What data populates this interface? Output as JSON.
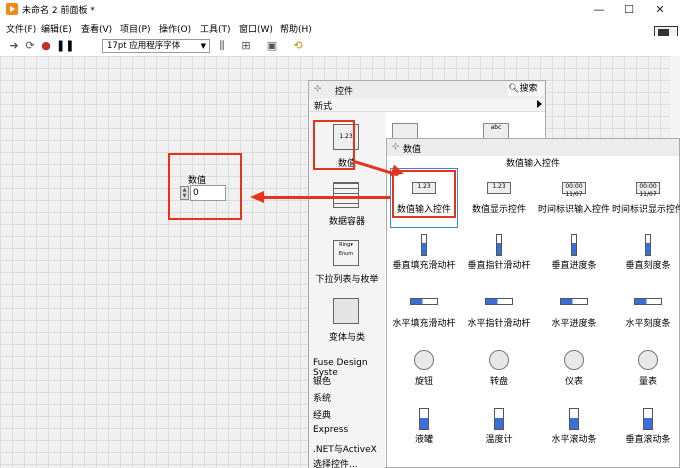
{
  "window": {
    "title": "未命名 2 前面板 *"
  },
  "menu": [
    "文件(F)",
    "编辑(E)",
    "查看(V)",
    "项目(P)",
    "操作(O)",
    "工具(T)",
    "窗口(W)",
    "帮助(H)"
  ],
  "toolbar": {
    "font": "17pt 应用程序字体"
  },
  "control": {
    "label": "数值",
    "value": "0"
  },
  "palette": {
    "title": "控件",
    "search": "搜索",
    "section": "新式",
    "categories": [
      "数值",
      "数据容器",
      "下拉列表与枚举",
      "变体与类"
    ],
    "more": [
      "Fuse Design Syste",
      "银色",
      "系统",
      "经典",
      "Express",
      ".NET与ActiveX",
      "选择控件..."
    ],
    "cat_icon_text": {
      "numeric": "1.23",
      "ring": "Ring▾",
      "enum": "Enum"
    }
  },
  "subpalette": {
    "title": "数值",
    "subtitle": "数值输入控件",
    "items": [
      "数值输入控件",
      "数值显示控件",
      "时间标识输入控件",
      "时间标识显示控件",
      "垂直填充滑动杆",
      "垂直指针滑动杆",
      "垂直进度条",
      "垂直刻度条",
      "水平填充滑动杆",
      "水平指针滑动杆",
      "水平进度条",
      "水平刻度条",
      "旋钮",
      "转盘",
      "仪表",
      "量表",
      "液罐",
      "温度计",
      "水平滚动条",
      "垂直滚动条"
    ],
    "icon_text": {
      "numeric": "1.23",
      "time": "00:00 11/07"
    }
  },
  "colors": {
    "highlight": "#e5331c",
    "selected": "#3a86d8"
  }
}
